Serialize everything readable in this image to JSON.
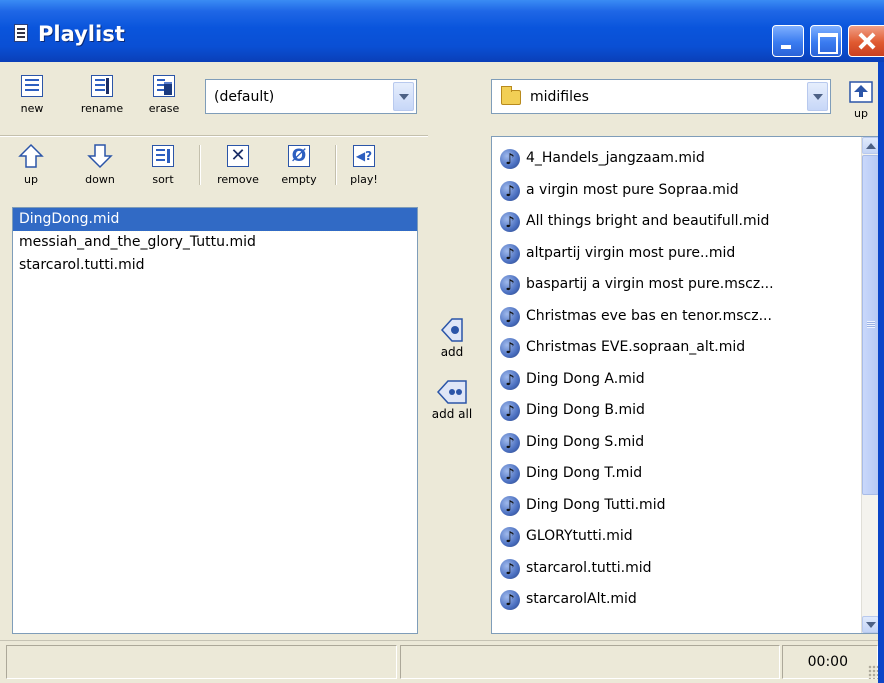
{
  "window": {
    "title": "Playlist"
  },
  "playlist_toolbar": {
    "new_label": "new",
    "rename_label": "rename",
    "erase_label": "erase",
    "playlist_select_value": "(default)"
  },
  "playlist_actions": {
    "up_label": "up",
    "down_label": "down",
    "sort_label": "sort",
    "remove_label": "remove",
    "empty_label": "empty",
    "play_label": "play!"
  },
  "playlist": {
    "items": [
      "DingDong.mid",
      "messiah_and_the_glory_Tuttu.mid",
      "starcarol.tutti.mid"
    ],
    "selected_index": 0
  },
  "middle": {
    "add_label": "add",
    "add_all_label": "add all"
  },
  "browser": {
    "folder_value": "midifiles",
    "up_label": "up",
    "files": [
      "4_Handels_jangzaam.mid",
      "a virgin most pure Sopraa.mid",
      "All things bright and beautifull.mid",
      "altpartij virgin most pure..mid",
      "baspartij a virgin most pure.mscz...",
      "Christmas eve bas en tenor.mscz...",
      "Christmas EVE.sopraan_alt.mid",
      "Ding Dong A.mid",
      "Ding Dong B.mid",
      "Ding Dong S.mid",
      "Ding Dong T.mid",
      "Ding Dong Tutti.mid",
      "GLORYtutti.mid",
      "starcarol.tutti.mid",
      "starcarolAlt.mid"
    ]
  },
  "statusbar": {
    "time": "00:00"
  },
  "colors": {
    "titlebar": "#0a55dc",
    "selection": "#316ac5",
    "window_bg": "#ece9d8"
  }
}
